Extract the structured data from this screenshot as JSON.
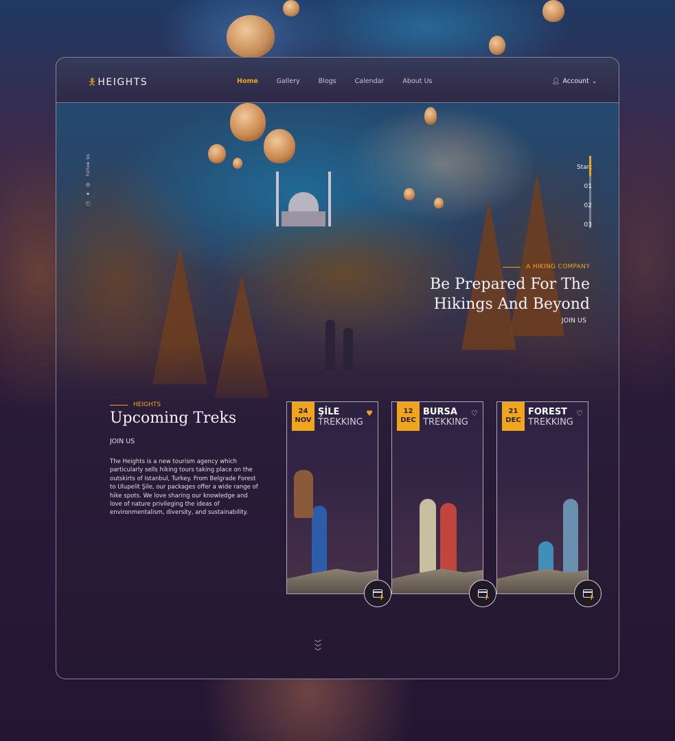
{
  "brand": {
    "name": "HEIGHTS",
    "icon": "hiker-icon",
    "accent": "#f0a61c"
  },
  "nav": {
    "items": [
      {
        "label": "Home",
        "active": true
      },
      {
        "label": "Gallery",
        "active": false
      },
      {
        "label": "Blogs",
        "active": false
      },
      {
        "label": "Calendar",
        "active": false
      },
      {
        "label": "About Us",
        "active": false
      }
    ],
    "account_label": "Account"
  },
  "social": {
    "follow_label": "Follow Us",
    "icons": [
      "instagram-icon",
      "twitter-icon",
      "facebook-icon"
    ]
  },
  "slider": {
    "labels": [
      "Start",
      "01",
      "02",
      "03"
    ],
    "active_index": 0
  },
  "hero": {
    "eyebrow": "A HIKING COMPANY",
    "title_line1": "Be Prepared For The",
    "title_line2": "Hikings And Beyond",
    "cta": "JOIN US"
  },
  "upcoming": {
    "eyebrow": "HEIGHTS",
    "title": "Upcoming Treks",
    "cta": "JOIN US",
    "description": "The Heights is a new tourism agency which particularly sells hiking tours taking place on the outskirts of Istanbul, Turkey. From Belgrade Forest to Ulupelit Şile, our packages offer a wide range of hike spots. We love sharing our knowledge and love of nature privileging the ideas of environmentalism, diversity, and sustainability."
  },
  "treks": [
    {
      "day": "24",
      "month": "NOV",
      "name": "ŞİLE",
      "type": "TREKKING",
      "favorited": true
    },
    {
      "day": "12",
      "month": "DEC",
      "name": "BURSA",
      "type": "TREKKING",
      "favorited": false
    },
    {
      "day": "21",
      "month": "DEC",
      "name": "FOREST",
      "type": "TREKKING",
      "favorited": false
    }
  ],
  "scroll_icon": "chevrons-down-icon"
}
